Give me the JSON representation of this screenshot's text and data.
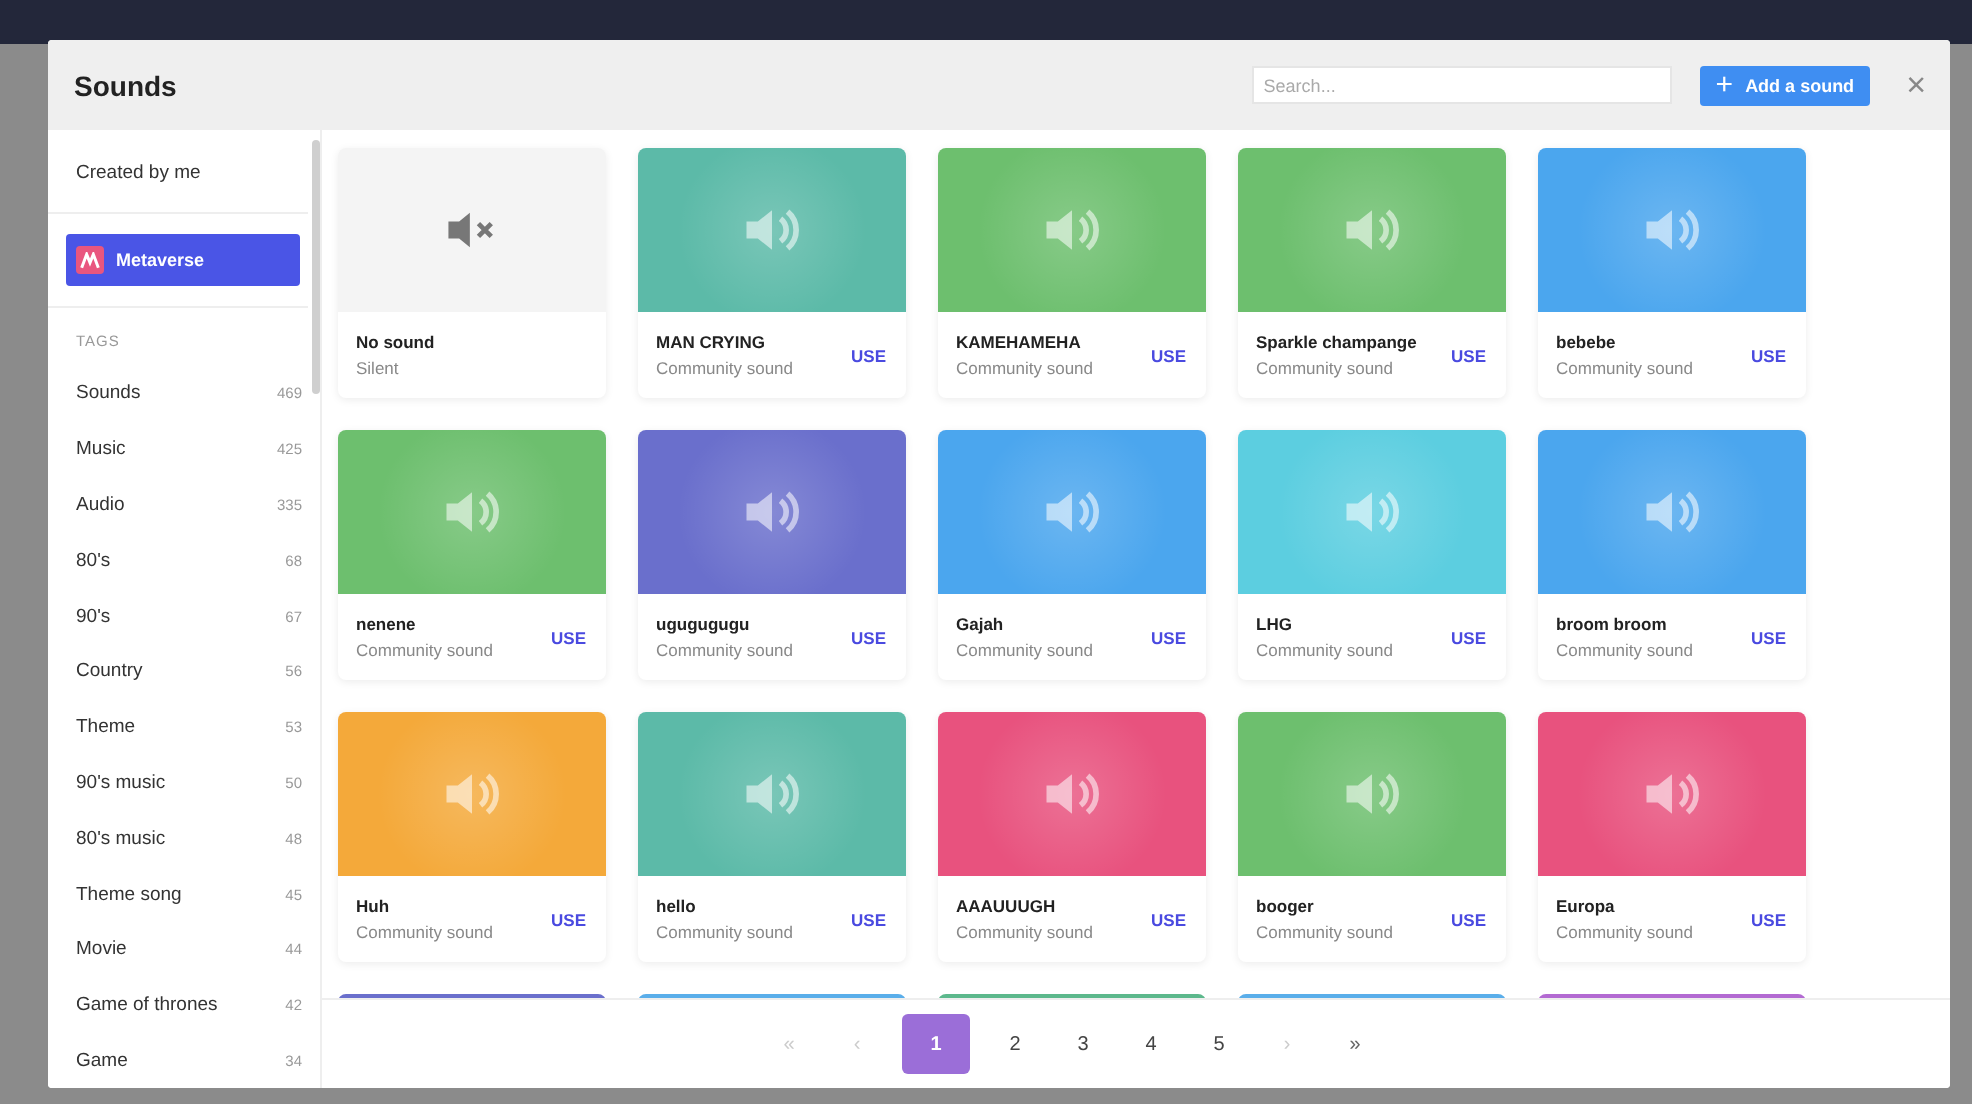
{
  "dialog": {
    "title": "Sounds",
    "search": {
      "placeholder": "Search..."
    },
    "add_button": {
      "icon": "+",
      "label": "Add a sound"
    },
    "close": "×"
  },
  "sidebar": {
    "created_by_me": "Created by me",
    "workspace": {
      "label": "Metaverse",
      "selected": true
    },
    "tags_heading": "TAGS",
    "tags": [
      {
        "name": "Sounds",
        "count": "469"
      },
      {
        "name": "Music",
        "count": "425"
      },
      {
        "name": "Audio",
        "count": "335"
      },
      {
        "name": "80's",
        "count": "68"
      },
      {
        "name": "90's",
        "count": "67"
      },
      {
        "name": "Country",
        "count": "56"
      },
      {
        "name": "Theme",
        "count": "53"
      },
      {
        "name": "90's music",
        "count": "50"
      },
      {
        "name": "80's music",
        "count": "48"
      },
      {
        "name": "Theme song",
        "count": "45"
      },
      {
        "name": "Movie",
        "count": "44"
      },
      {
        "name": "Game of thrones",
        "count": "42"
      },
      {
        "name": "Game",
        "count": "34"
      }
    ]
  },
  "sounds": [
    {
      "kind": "silent",
      "title": "No sound",
      "subtitle": "Silent"
    },
    {
      "kind": "community",
      "title": "MAN CRYING",
      "subtitle": "Community sound",
      "action": "USE",
      "color": "#5cbaa8"
    },
    {
      "kind": "community",
      "title": "KAMEHAMEHA",
      "subtitle": "Community sound",
      "action": "USE",
      "color": "#6dbf6e"
    },
    {
      "kind": "community",
      "title": "Sparkle champange",
      "subtitle": "Community sound",
      "action": "USE",
      "color": "#6dbf6e"
    },
    {
      "kind": "community",
      "title": "bebebe",
      "subtitle": "Community sound",
      "action": "USE",
      "color": "#4ba6ee"
    },
    {
      "kind": "community",
      "title": "nenene",
      "subtitle": "Community sound",
      "action": "USE",
      "color": "#6dbf6e"
    },
    {
      "kind": "community",
      "title": "ugugugugu",
      "subtitle": "Community sound",
      "action": "USE",
      "color": "#6a6fcc"
    },
    {
      "kind": "community",
      "title": "Gajah",
      "subtitle": "Community sound",
      "action": "USE",
      "color": "#4ba6ee"
    },
    {
      "kind": "community",
      "title": "LHG",
      "subtitle": "Community sound",
      "action": "USE",
      "color": "#5ccee0"
    },
    {
      "kind": "community",
      "title": "broom broom",
      "subtitle": "Community sound",
      "action": "USE",
      "color": "#4ba6ee"
    },
    {
      "kind": "community",
      "title": "Huh",
      "subtitle": "Community sound",
      "action": "USE",
      "color": "#f4a93a"
    },
    {
      "kind": "community",
      "title": "hello",
      "subtitle": "Community sound",
      "action": "USE",
      "color": "#5cbaa8"
    },
    {
      "kind": "community",
      "title": "AAAUUUGH",
      "subtitle": "Community sound",
      "action": "USE",
      "color": "#e8527e"
    },
    {
      "kind": "community",
      "title": "booger",
      "subtitle": "Community sound",
      "action": "USE",
      "color": "#6dbf6e"
    },
    {
      "kind": "community",
      "title": "Europa",
      "subtitle": "Community sound",
      "action": "USE",
      "color": "#e8527e"
    }
  ],
  "partial_row": [
    {
      "color": "#6a6fcc"
    },
    {
      "color": "#5aaeea"
    },
    {
      "color": "#5cb88c"
    },
    {
      "color": "#5aaeea"
    },
    {
      "color": "#b36ad2"
    }
  ],
  "pagination": [
    {
      "label": "«",
      "kind": "nav",
      "disabled": true
    },
    {
      "label": "‹",
      "kind": "nav",
      "disabled": true
    },
    {
      "label": "1",
      "kind": "page",
      "selected": true
    },
    {
      "label": "2",
      "kind": "page",
      "selected": false
    },
    {
      "label": "3",
      "kind": "page",
      "selected": false
    },
    {
      "label": "4",
      "kind": "page",
      "selected": false
    },
    {
      "label": "5",
      "kind": "page",
      "selected": false
    },
    {
      "label": "›",
      "kind": "nav",
      "disabled": true
    },
    {
      "label": "»",
      "kind": "nav",
      "disabled": false
    }
  ]
}
